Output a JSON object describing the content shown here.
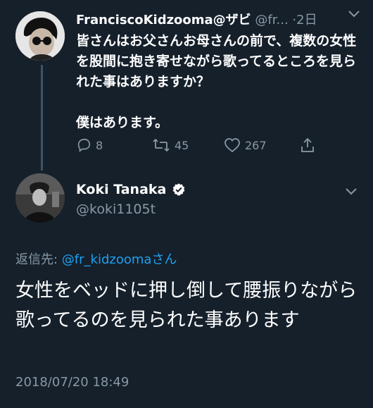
{
  "thread_parent": {
    "display_name": "FranciscoKidzooma@ザビ",
    "handle_trunc": "@fr...",
    "time_ago": "·2日",
    "text": "皆さんはお父さんお母さんの前で、複数の女性を股間に抱き寄せながら歌ってるところを見られた事はありますか？\n\n僕はあります。",
    "actions": {
      "replies": "8",
      "retweets": "45",
      "likes": "267"
    }
  },
  "focused_tweet": {
    "display_name": "Koki Tanaka",
    "handle": "@koki1105t",
    "reply_prefix": "返信先: ",
    "reply_to": "@fr_kidzoomaさん",
    "text": "女性をベッドに押し倒して腰振りながら歌ってるのを見られた事あります",
    "timestamp": "2018/07/20 18:49"
  },
  "colors": {
    "background": "#15202b",
    "muted": "#8899a6",
    "link": "#1da1f2",
    "verified": "#ffffff"
  },
  "icons": [
    "reply-icon",
    "retweet-icon",
    "like-icon",
    "share-icon",
    "chevron-down-icon",
    "verified-badge-icon"
  ]
}
